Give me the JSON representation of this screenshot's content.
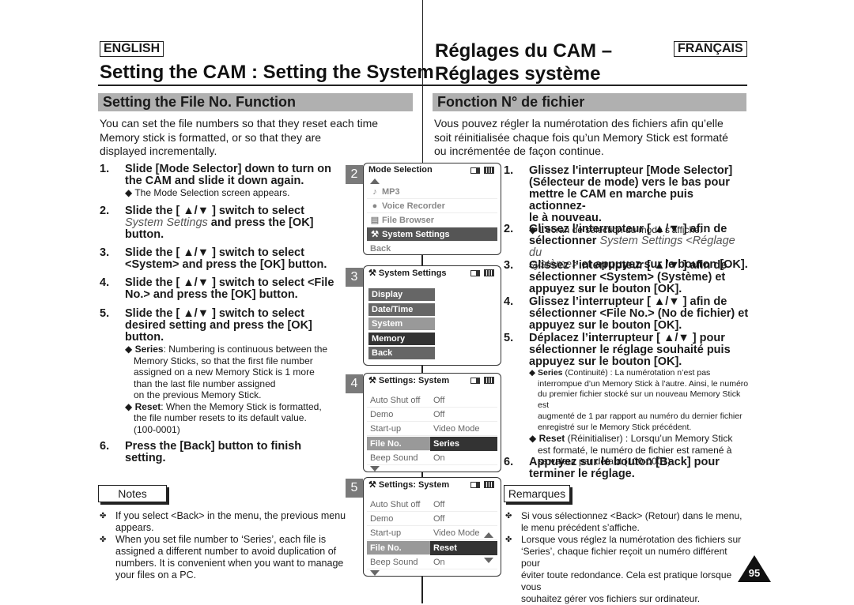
{
  "english": {
    "lang_badge": "ENGLISH",
    "title": "Setting the CAM : Setting the System",
    "section": "Setting the File No. Function",
    "intro": [
      "You can set the file numbers so that they reset each time",
      "Memory stick is formatted, or so that they are",
      "displayed incrementally."
    ],
    "steps": [
      {
        "num": "1.",
        "lines": [
          "Slide [Mode Selector] down to turn on",
          "the CAM and slide it down again."
        ],
        "sub": [
          "◆ The Mode Selection screen appears."
        ]
      },
      {
        "num": "2.",
        "lines_html": [
          "Slide the [ ▲/▼ ] switch to select",
          "System Settings",
          " and press the [OK]",
          "button."
        ]
      },
      {
        "num": "3.",
        "lines": [
          "Slide the [ ▲/▼ ] switch to select",
          "<System> and press the [OK] button."
        ]
      },
      {
        "num": "4.",
        "lines": [
          "Slide the [ ▲/▼ ] switch to select <File",
          "No.> and press the [OK] button."
        ]
      },
      {
        "num": "5.",
        "lines": [
          "Slide the [ ▲/▼ ] switch to select",
          "desired setting and press the [OK]",
          "button."
        ],
        "series_label": "Series",
        "series_text": [
          ": Numbering is continuous between the",
          "Memory Sticks, so that the first file number",
          "assigned on a new Memory Stick is 1 more",
          "than the last file number assigned",
          "on the previous Memory Stick."
        ],
        "reset_label": "Reset",
        "reset_text": [
          ": When the Memory Stick is formatted,",
          "the file number resets to its default value.",
          "(100-0001)"
        ]
      },
      {
        "num": "6.",
        "lines": [
          "Press the [Back] button to finish",
          "setting."
        ]
      }
    ],
    "notes_label": "Notes",
    "notes": [
      [
        "If you select <Back> in the menu, the previous menu",
        "appears."
      ],
      [
        "When you set file number to ‘Series’, each file is",
        "assigned a different number to avoid duplication of",
        "numbers. It is convenient when you want to manage",
        "your files on a PC."
      ]
    ]
  },
  "french": {
    "lang_badge": "FRANÇAIS",
    "title": [
      "Réglages du CAM –",
      "Réglages système"
    ],
    "section": "Fonction N° de fichier",
    "intro": [
      "Vous pouvez régler la numérotation des fichiers afin qu’elle",
      "soit réinitialisée chaque fois qu’un Memory Stick est formaté",
      "ou incrémentée de façon continue."
    ],
    "steps": [
      {
        "num": "1.",
        "lines": [
          "Glissez l'interrupteur [Mode Selector]",
          "(Sélecteur de mode) vers le bas pour",
          "mettre le CAM en marche puis actionnez-",
          "le à nouveau."
        ],
        "sub": "◆ L’écran de sélection du mode s’affiche."
      },
      {
        "num": "2.",
        "l1": "Glissez l’interrupteur [ ▲/▼ ] afin de",
        "l2a": "sélectionner ",
        "l2b": "System Settings <Réglage du",
        "l3a": "système>",
        "l3b": " et appuyez sur le bouton [OK]."
      },
      {
        "num": "3.",
        "lines": [
          "Glissez l’interrupteur [ ▲/▼ ] afin de",
          "sélectionner <System> (Système) et",
          "appuyez sur le bouton [OK]."
        ]
      },
      {
        "num": "4.",
        "lines": [
          "Glissez l’interrupteur [ ▲/▼ ] afin de",
          "sélectionner <File No.> (No de fichier) et",
          "appuyez sur le bouton [OK]."
        ]
      },
      {
        "num": "5.",
        "lines": [
          "Déplacez l’interrupteur [ ▲/▼ ] pour",
          "sélectionner le réglage souhaité puis",
          "appuyez sur le bouton [OK]."
        ],
        "series_label": "Series",
        "series_text": [
          " (Continuité) : La numérotation n’est pas",
          "interrompue d’un Memory Stick à l’autre. Ainsi, le numéro",
          "du premier fichier stocké sur un nouveau Memory Stick est",
          "augmenté de 1 par rapport au numéro du dernier fichier",
          "enregistré sur le Memory Stick précédent."
        ],
        "reset_label": "Reset",
        "reset_text": [
          " (Réinitialiser) : Lorsqu’un Memory Stick",
          "est formaté, le numéro de fichier est ramené à",
          "sa valeur par défaut (100-0001)"
        ]
      },
      {
        "num": "6.",
        "lines": [
          "Appuyez sur le bouton [Back] pour",
          "terminer le réglage."
        ]
      }
    ],
    "notes_label": "Remarques",
    "notes": [
      [
        "Si vous sélectionnez <Back> (Retour) dans le menu,",
        "le menu précédent s’affiche."
      ],
      [
        "Lorsque vous réglez la numérotation des fichiers sur",
        "‘Series’, chaque fichier reçoit un numéro différent pour",
        "éviter toute redondance. Cela est pratique lorsque vous",
        "souhaitez gérer vos fichiers sur ordinateur."
      ]
    ]
  },
  "screens": [
    {
      "num": "2",
      "header": "Mode Selection",
      "items": [
        {
          "icon": "♪",
          "label": "MP3"
        },
        {
          "icon": "🎙",
          "label": "Voice Recorder"
        },
        {
          "icon": "▤",
          "label": "File Browser"
        },
        {
          "icon": "⚒",
          "label": "System Settings",
          "selected": true
        },
        {
          "icon": "",
          "label": "Back"
        }
      ]
    },
    {
      "num": "3",
      "header": "System Settings",
      "items": [
        {
          "label": "Display"
        },
        {
          "label": "Date/Time"
        },
        {
          "label": "System",
          "style": "light"
        },
        {
          "label": "Memory",
          "style": "dark"
        },
        {
          "label": "Back"
        }
      ]
    },
    {
      "num": "4",
      "header": "Settings: System",
      "rows": [
        {
          "k": "Auto Shut off",
          "v": "Off"
        },
        {
          "k": "Demo",
          "v": "Off"
        },
        {
          "k": "Start-up",
          "v": "Video Mode"
        },
        {
          "k": "File No.",
          "v": "Series",
          "hl": true
        },
        {
          "k": "Beep Sound",
          "v": "On"
        }
      ]
    },
    {
      "num": "5",
      "header": "Settings: System",
      "rows": [
        {
          "k": "Auto Shut off",
          "v": "Off"
        },
        {
          "k": "Demo",
          "v": "Off"
        },
        {
          "k": "Start-up",
          "v": "Video Mode"
        },
        {
          "k": "File No.",
          "v": "Reset",
          "hl": true
        },
        {
          "k": "Beep Sound",
          "v": "On"
        }
      ]
    }
  ],
  "page_number": "95",
  "bullet_glyph": "✤"
}
